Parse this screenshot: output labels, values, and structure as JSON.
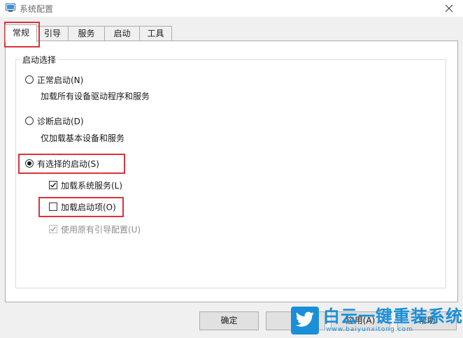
{
  "window": {
    "title": "系统配置"
  },
  "tabs": [
    {
      "label": "常规",
      "active": true
    },
    {
      "label": "引导",
      "active": false
    },
    {
      "label": "服务",
      "active": false
    },
    {
      "label": "启动",
      "active": false
    },
    {
      "label": "工具",
      "active": false
    }
  ],
  "startup": {
    "group_label": "启动选择",
    "normal": {
      "label": "正常启动(N)",
      "description": "加载所有设备驱动程序和服务",
      "checked": false
    },
    "diagnostic": {
      "label": "诊断启动(D)",
      "description": "仅加载基本设备和服务",
      "checked": false
    },
    "selective": {
      "label": "有选择的启动(S)",
      "checked": true
    },
    "options": [
      {
        "label": "加载系统服务(L)",
        "checked": true,
        "enabled": true
      },
      {
        "label": "加载启动项(O)",
        "checked": false,
        "enabled": true
      },
      {
        "label": "使用原有引导配置(U)",
        "checked": true,
        "enabled": false
      }
    ]
  },
  "buttons": {
    "ok": "确定",
    "cancel": "",
    "apply": "应用(A)",
    "help": "帮助"
  },
  "watermark": {
    "title": "白云一键重装系统",
    "url": "www.baiyunxitong.com"
  },
  "colors": {
    "highlight": "#d9343a",
    "watermark_blue": "#1a8fd8"
  }
}
